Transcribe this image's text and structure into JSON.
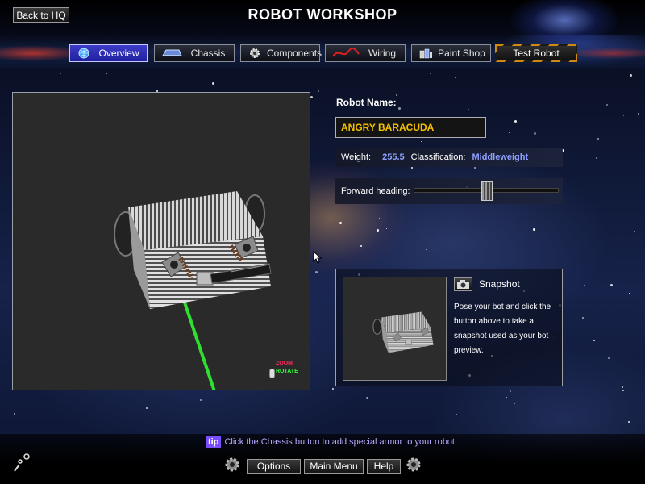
{
  "title": "ROBOT WORKSHOP",
  "back_button": "Back to HQ",
  "tabs": [
    {
      "label": "Overview",
      "icon": "globe-icon",
      "active": true
    },
    {
      "label": "Chassis",
      "icon": "chassis-icon",
      "active": false
    },
    {
      "label": "Components",
      "icon": "gear-icon",
      "active": false
    },
    {
      "label": "Wiring",
      "icon": "wire-icon",
      "active": false
    },
    {
      "label": "Paint Shop",
      "icon": "paint-can-icon",
      "active": false
    },
    {
      "label": "Test Robot",
      "icon": "hazard-stripe",
      "active": false
    }
  ],
  "robot": {
    "name_label": "Robot Name:",
    "name": "ANGRY BARACUDA",
    "weight_label": "Weight:",
    "weight": "255.5",
    "class_label": "Classification:",
    "classification": "Middleweight",
    "heading_label": "Forward heading:",
    "heading_value": 0.5
  },
  "viewport": {
    "zoom_label": "ZOOM",
    "rotate_label": "ROTATE"
  },
  "snapshot": {
    "title": "Snapshot",
    "description": "Pose your bot and click the button above to take a snapshot used as your bot preview."
  },
  "tip": {
    "badge": "tip",
    "text": "Click the Chassis button to add special armor to your robot."
  },
  "bottom_buttons": {
    "options": "Options",
    "main_menu": "Main Menu",
    "help": "Help"
  },
  "colors": {
    "accent_tab": "#2a2ab0",
    "name_text": "#f4c000",
    "stat_value": "#8fa0ff",
    "zoom": "#ff2a5a",
    "rotate": "#30ff30",
    "tip_badge": "#7a4dff"
  }
}
